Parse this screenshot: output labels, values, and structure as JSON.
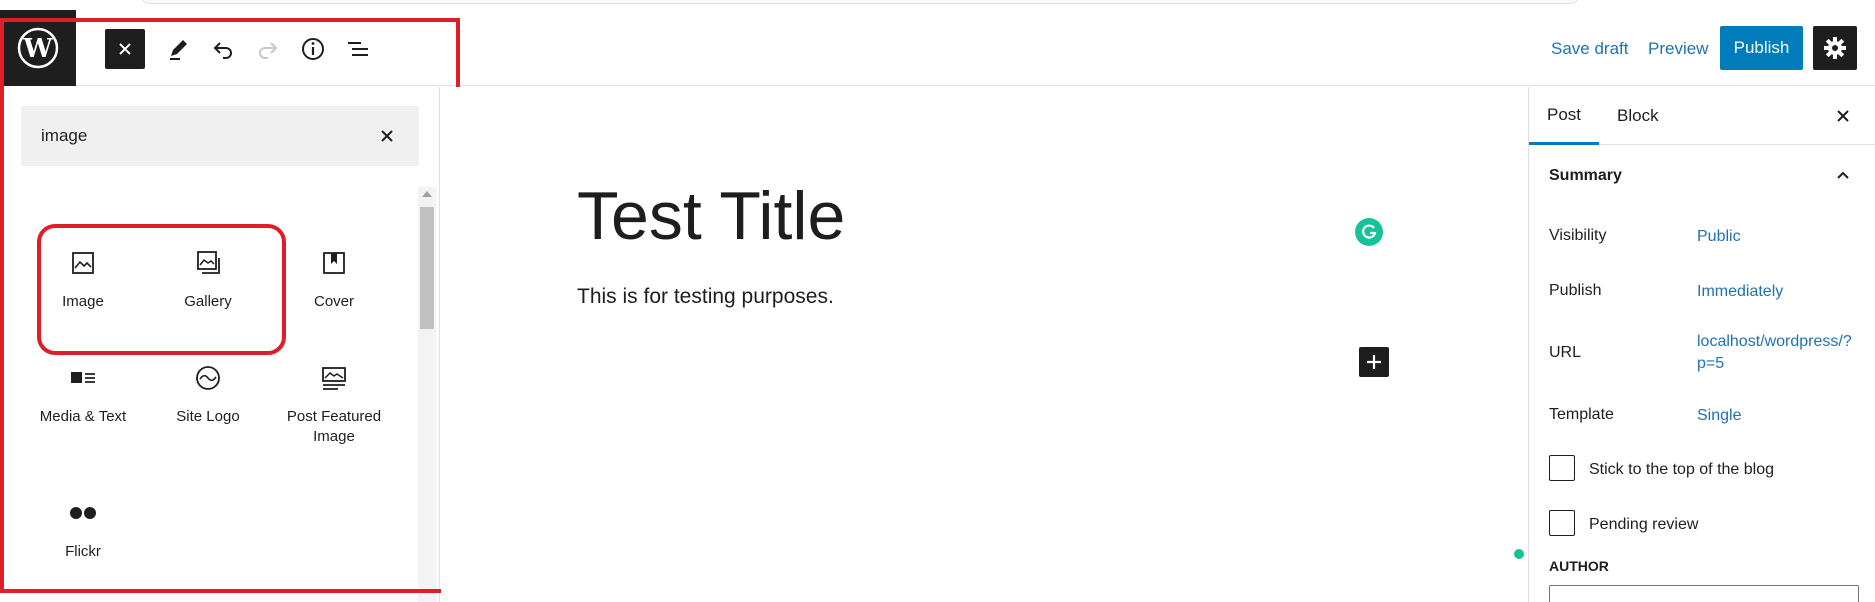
{
  "header": {
    "save_draft": "Save draft",
    "preview": "Preview",
    "publish": "Publish"
  },
  "inserter": {
    "search_value": "image",
    "blocks": [
      {
        "label": "Image",
        "icon": "image-icon"
      },
      {
        "label": "Gallery",
        "icon": "gallery-icon"
      },
      {
        "label": "Cover",
        "icon": "cover-icon"
      },
      {
        "label": "Media & Text",
        "icon": "media-text-icon"
      },
      {
        "label": "Site Logo",
        "icon": "site-logo-icon"
      },
      {
        "label": "Post Featured Image",
        "icon": "featured-image-icon"
      },
      {
        "label": "Flickr",
        "icon": "flickr-icon"
      }
    ]
  },
  "editor": {
    "title": "Test Title",
    "paragraph": "This is for testing purposes."
  },
  "sidebar": {
    "tabs": [
      "Post",
      "Block"
    ],
    "summary": "Summary",
    "rows": [
      {
        "label": "Visibility",
        "value": "Public"
      },
      {
        "label": "Publish",
        "value": "Immediately"
      },
      {
        "label": "URL",
        "value": "localhost/wordpress/?p=5"
      },
      {
        "label": "Template",
        "value": "Single"
      }
    ],
    "checkboxes": [
      "Stick to the top of the blog",
      "Pending review"
    ],
    "author_label": "AUTHOR"
  },
  "colors": {
    "accent": "#007cba",
    "link": "#2271b1",
    "highlight": "#e01e2a",
    "grammarly": "#15c39a"
  }
}
